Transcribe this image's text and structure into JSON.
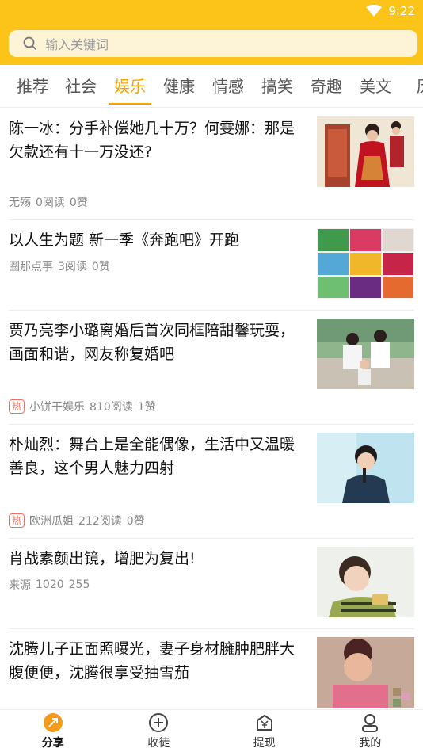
{
  "status": {
    "time": "9:22"
  },
  "search": {
    "placeholder": "输入关键词"
  },
  "tabs": [
    {
      "label": "推荐"
    },
    {
      "label": "社会"
    },
    {
      "label": "娱乐"
    },
    {
      "label": "健康"
    },
    {
      "label": "情感"
    },
    {
      "label": "搞笑"
    },
    {
      "label": "奇趣"
    },
    {
      "label": "美文"
    },
    {
      "label": "历"
    }
  ],
  "feed": [
    {
      "title": "陈一冰：分手补偿她几十万？何雯娜：那是欠款还有十一万没还?",
      "source": "无殇",
      "reads": "0阅读",
      "likes": "0赞"
    },
    {
      "title": "以人生为题 新一季《奔跑吧》开跑",
      "source": "圈那点事",
      "reads": "3阅读",
      "likes": "0赞"
    },
    {
      "title": "贾乃亮李小璐离婚后首次同框陪甜馨玩耍，画面和谐，网友称复婚吧",
      "hot": "热",
      "source": "小饼干娱乐",
      "reads": "810阅读",
      "likes": "1赞"
    },
    {
      "title": "朴灿烈：舞台上是全能偶像，生活中又温暖善良，这个男人魅力四射",
      "hot": "热",
      "source": "欧洲瓜姐",
      "reads": "212阅读",
      "likes": "0赞"
    },
    {
      "title": "肖战素颜出镜，增肥为复出!",
      "source": "来源",
      "reads": "1020",
      "likes": "255"
    },
    {
      "title": "沈腾儿子正面照曝光，妻子身材臃肿肥胖大腹便便，沈腾很享受抽雪茄"
    }
  ],
  "nav": [
    {
      "label": "分享",
      "icon": "share-icon"
    },
    {
      "label": "收徒",
      "icon": "plus-circle-icon"
    },
    {
      "label": "提现",
      "icon": "yen-icon"
    },
    {
      "label": "我的",
      "icon": "user-icon"
    }
  ],
  "colors": {
    "brand": "#fcc419",
    "active_tab": "#f5a300",
    "hot": "#f0705a"
  }
}
